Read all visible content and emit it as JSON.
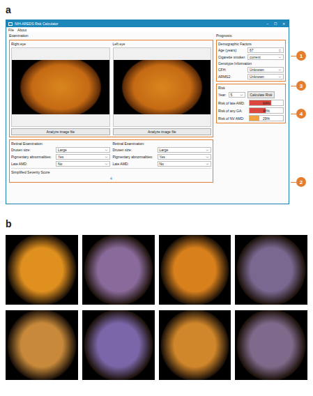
{
  "panel_a": {
    "label": "a",
    "window": {
      "title": "NIH-AREDS Risk Calculator",
      "controls": [
        "–",
        "☐",
        "✕"
      ]
    },
    "menu": [
      "File",
      "About"
    ],
    "examination": {
      "title": "Examination",
      "eyes": [
        {
          "label": "Right eye",
          "button": "Analyze image file",
          "exam_title": "Retinal Examination:",
          "fields": [
            {
              "label": "Drusen size:",
              "value": "Large"
            },
            {
              "label": "Pigmentary abnormalities:",
              "value": "Yes"
            },
            {
              "label": "Late AMD:",
              "value": "No"
            }
          ]
        },
        {
          "label": "Left eye",
          "button": "Analyze image file",
          "exam_title": "Retinal Examination:",
          "fields": [
            {
              "label": "Drusen size:",
              "value": "Large"
            },
            {
              "label": "Pigmentary abnormalities:",
              "value": "Yes"
            },
            {
              "label": "Late AMD:",
              "value": "No"
            }
          ]
        }
      ],
      "severity": {
        "label": "Simplified Severity Score",
        "value": "4"
      }
    },
    "prognosis": {
      "title": "Prognosis:",
      "groups": [
        {
          "title": "Demographic Factors",
          "fields": [
            {
              "label": "Age (years):",
              "value": "67",
              "kind": "spin"
            },
            {
              "label": "Cigarette smoker:",
              "value": "current",
              "kind": "select"
            }
          ]
        },
        {
          "title": "Genotype Information",
          "fields": [
            {
              "label": "CFH:",
              "value": "Unknown",
              "kind": "select"
            },
            {
              "label": "ARMS2:",
              "value": "Unknown",
              "kind": "select"
            }
          ]
        }
      ],
      "risk": {
        "title": "Risk",
        "year_label": "Year:",
        "year": "5",
        "button": "Calculate Risk",
        "rows": [
          {
            "label": "Risk of late AMD:",
            "reading": "64%",
            "level": 0.64,
            "color": "#d9473f"
          },
          {
            "label": "Risk of any GA:",
            "reading": "48%",
            "level": 0.48,
            "color": "#d9473f"
          },
          {
            "label": "Risk of NV AMD:",
            "reading": "29%",
            "level": 0.29,
            "color": "#f0a23c"
          }
        ]
      }
    },
    "callouts": [
      {
        "number": "1",
        "target": "images"
      },
      {
        "number": "2",
        "target": "exam"
      },
      {
        "number": "3",
        "target": "factors"
      },
      {
        "number": "4",
        "target": "risk"
      }
    ]
  },
  "panel_b": {
    "label": "b",
    "images": [
      {
        "color": "#e0901e"
      },
      {
        "color": "#8a6a9a"
      },
      {
        "color": "#d8801c"
      },
      {
        "color": "#7a6890"
      },
      {
        "color": "#c88a3a"
      },
      {
        "color": "#7a66a8"
      },
      {
        "color": "#d0862a"
      },
      {
        "color": "#806a8c"
      }
    ]
  }
}
